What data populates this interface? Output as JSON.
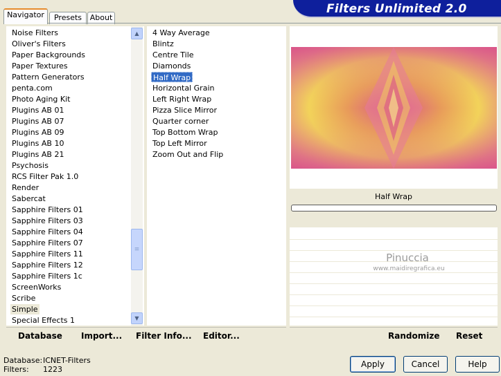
{
  "banner": {
    "title": "Filters Unlimited 2.0"
  },
  "tabs": [
    {
      "label": "Navigator"
    },
    {
      "label": "Presets"
    },
    {
      "label": "About"
    }
  ],
  "categories": {
    "items": [
      "Noise Filters",
      "Oliver's Filters",
      "Paper Backgrounds",
      "Paper Textures",
      "Pattern Generators",
      "penta.com",
      "Photo Aging Kit",
      "Plugins AB 01",
      "Plugins AB 07",
      "Plugins AB 09",
      "Plugins AB 10",
      "Plugins AB 21",
      "Psychosis",
      "RCS Filter Pak 1.0",
      "Render",
      "Sabercat",
      "Sapphire Filters 01",
      "Sapphire Filters 03",
      "Sapphire Filters 04",
      "Sapphire Filters 07",
      "Sapphire Filters 11",
      "Sapphire Filters 12",
      "Sapphire Filters 1c",
      "ScreenWorks",
      "Scribe",
      "Simple",
      "Special Effects 1"
    ],
    "highlighted": "Simple"
  },
  "filters": {
    "items": [
      "4 Way Average",
      "Blintz",
      "Centre Tile",
      "Diamonds",
      "Half Wrap",
      "Horizontal Grain",
      "Left Right Wrap",
      "Pizza Slice Mirror",
      "Quarter corner",
      "Top Bottom Wrap",
      "Top Left Mirror",
      "Zoom Out and Flip"
    ],
    "selected": "Half Wrap"
  },
  "preview": {
    "filter_name": "Half Wrap",
    "watermark_name": "Pinuccia",
    "watermark_url": "www.maidiregrafica.eu",
    "colors": {
      "pink": "#d9508a",
      "yellow": "#f2d35a",
      "orange": "#e89a5a"
    }
  },
  "toolbar_left": {
    "database": "Database",
    "import": "Import...",
    "filter_info": "Filter Info...",
    "editor": "Editor..."
  },
  "toolbar_right": {
    "randomize": "Randomize",
    "reset": "Reset"
  },
  "status": {
    "database_label": "Database:",
    "database_value": "ICNET-Filters",
    "filters_label": "Filters:",
    "filters_value": "1223"
  },
  "buttons": {
    "apply": "Apply",
    "cancel": "Cancel",
    "help": "Help"
  },
  "colors": {
    "window_bg": "#ece9d8",
    "banner_bg": "#0e1f9c",
    "selection": "#316ac5"
  }
}
